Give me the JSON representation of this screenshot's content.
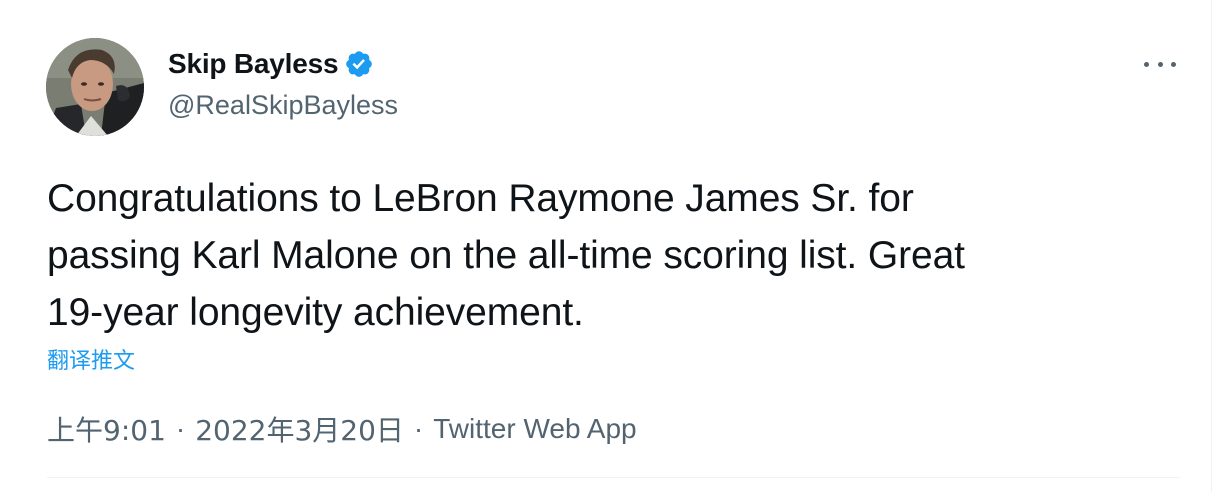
{
  "author": {
    "display_name": "Skip Bayless",
    "handle": "@RealSkipBayless",
    "verified": true,
    "avatar_icon": "profile-photo"
  },
  "menu": {
    "more_icon": "more-horizontal-icon"
  },
  "tweet": {
    "text": "Congratulations to LeBron Raymone James Sr. for\npassing Karl Malone on the all-time scoring list. Great\n19-year longevity achievement.",
    "translate_label": "翻译推文",
    "time": "上午9:01",
    "date": "2022年3月20日",
    "source": "Twitter Web App",
    "separator": "·"
  },
  "colors": {
    "text_primary": "#0f1419",
    "text_secondary": "#536471",
    "accent": "#1d9bf0",
    "verified": "#1d9bf0"
  }
}
